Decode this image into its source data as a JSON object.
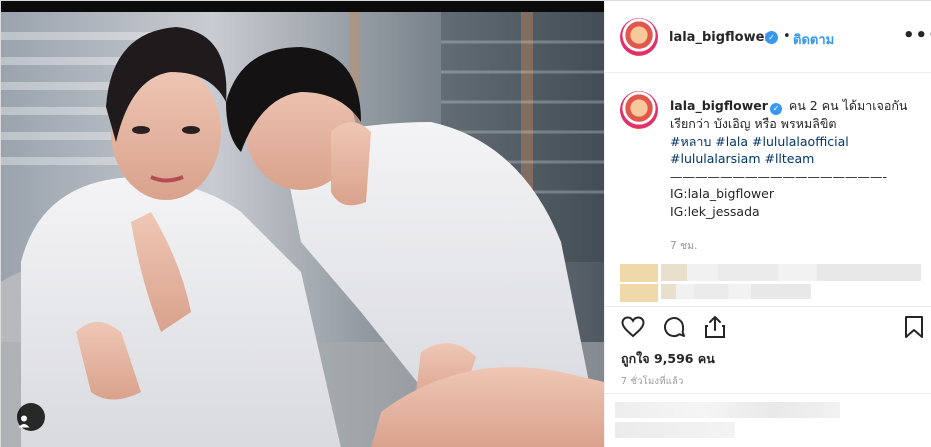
{
  "post": {
    "username": "lala_bigflower",
    "verified_badge": "✓",
    "separator": "•",
    "follow_label": "ติดตาม",
    "more_icon": "•••",
    "caption": {
      "username": "lala_bigflower",
      "text_line1": "คน 2 คน ได้มาเจอกัน",
      "text_line2": "เรียกว่า บังเอิญ หรือ พรหมลิขิต",
      "hashtags_line1": "#หลาบ #lala #lululalaofficial",
      "hashtags_line2": "#lululalarsiam #llteam",
      "divider": "—————————————————-",
      "ig1": "IG:lala_bigflower",
      "ig2": "IG:lek_jessada"
    },
    "time_ago": "7 ชม.",
    "likes_label": "ถูกใจ",
    "likes_count": "9,596",
    "likes_unit": "คน",
    "posted_ago": "7 ชั่วโมงที่แล้ว"
  },
  "icons": {
    "heart": "heart-icon",
    "comment": "comment-icon",
    "share": "share-icon",
    "bookmark": "bookmark-icon",
    "tag": "user-tag-icon",
    "more": "more-options-icon"
  },
  "colors": {
    "link_blue": "#3897f0",
    "hashtag": "#003569",
    "muted": "#999999",
    "border": "#efefef"
  }
}
